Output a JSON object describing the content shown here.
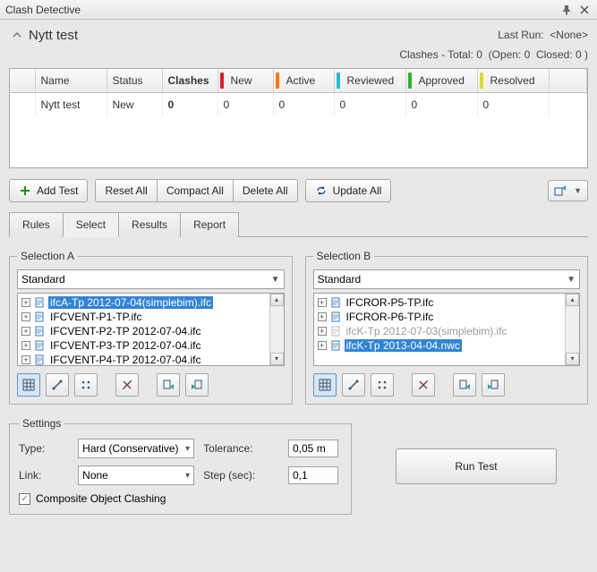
{
  "window": {
    "title": "Clash Detective"
  },
  "header": {
    "test_name": "Nytt test",
    "last_run_label": "Last Run:",
    "last_run_value": "<None>",
    "summary_prefix": "Clashes - Total:",
    "summary_total": "0",
    "summary_open_label": "(Open:",
    "summary_open": "0",
    "summary_closed_label": "Closed:",
    "summary_closed": "0 )"
  },
  "grid": {
    "cols": {
      "name": "Name",
      "status": "Status",
      "clashes": "Clashes",
      "new": "New",
      "active": "Active",
      "reviewed": "Reviewed",
      "approved": "Approved",
      "resolved": "Resolved"
    },
    "row": {
      "name": "Nytt test",
      "status": "New",
      "clashes": "0",
      "new": "0",
      "active": "0",
      "reviewed": "0",
      "approved": "0",
      "resolved": "0"
    }
  },
  "buttons": {
    "add_test": "Add Test",
    "reset_all": "Reset All",
    "compact_all": "Compact All",
    "delete_all": "Delete All",
    "update_all": "Update All"
  },
  "tabs": {
    "rules": "Rules",
    "select": "Select",
    "results": "Results",
    "report": "Report"
  },
  "selA": {
    "legend": "Selection A",
    "mode": "Standard",
    "items": [
      {
        "label": "ifcA-Tp 2012-07-04(simplebim).ifc",
        "selected": true
      },
      {
        "label": "IFCVENT-P1-TP.ifc"
      },
      {
        "label": "IFCVENT-P2-TP 2012-07-04.ifc"
      },
      {
        "label": "IFCVENT-P3-TP 2012-07-04.ifc"
      },
      {
        "label": "IFCVENT-P4-TP 2012-07-04.ifc"
      }
    ]
  },
  "selB": {
    "legend": "Selection B",
    "mode": "Standard",
    "items": [
      {
        "label": "IFCROR-P5-TP.ifc"
      },
      {
        "label": "IFCROR-P6-TP.ifc"
      },
      {
        "label": "ifcK-Tp 2012-07-03(simplebim).ifc",
        "grey": true
      },
      {
        "label": "ifcK-Tp 2013-04-04.nwc",
        "selected": true
      }
    ]
  },
  "settings": {
    "legend": "Settings",
    "type_label": "Type:",
    "type_value": "Hard (Conservative)",
    "tolerance_label": "Tolerance:",
    "tolerance_value": "0,05 m",
    "link_label": "Link:",
    "link_value": "None",
    "step_label": "Step (sec):",
    "step_value": "0,1",
    "composite_label": "Composite Object Clashing"
  },
  "run": {
    "label": "Run Test"
  }
}
